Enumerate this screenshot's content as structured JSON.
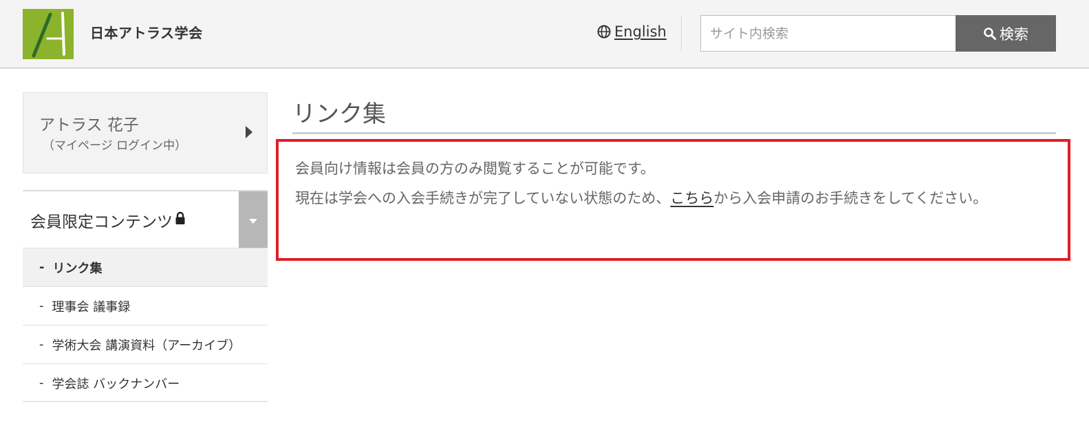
{
  "header": {
    "site_title": "日本アトラス学会",
    "language_link": "English",
    "search": {
      "placeholder": "サイト内検索",
      "value": "",
      "button_label": "検索"
    },
    "colors": {
      "logo_green": "#8bb32c",
      "search_button": "#666666"
    }
  },
  "sidebar": {
    "user": {
      "name": "アトラス 花子",
      "status": "（マイページ ログイン中）"
    },
    "section": {
      "title": "会員限定コンテンツ",
      "lock_icon": "lock-icon",
      "toggle_icon": "caret-down-icon"
    },
    "items": [
      {
        "dash": "-",
        "label": "リンク集",
        "active": true
      },
      {
        "dash": "-",
        "label": "理事会 議事録",
        "active": false
      },
      {
        "dash": "-",
        "label": "学術大会 講演資料（アーカイブ）",
        "active": false
      },
      {
        "dash": "-",
        "label": "学会誌 バックナンバー",
        "active": false
      }
    ]
  },
  "main": {
    "title": "リンク集",
    "notice": {
      "line1": "会員向け情報は会員の方のみ閲覧することが可能です。",
      "line2_before": "現在は学会への入会手続きが完了していない状態のため、",
      "link_text": "こちら",
      "line2_after": "から入会申請のお手続きをしてください。",
      "border_color": "#e11d26"
    }
  }
}
